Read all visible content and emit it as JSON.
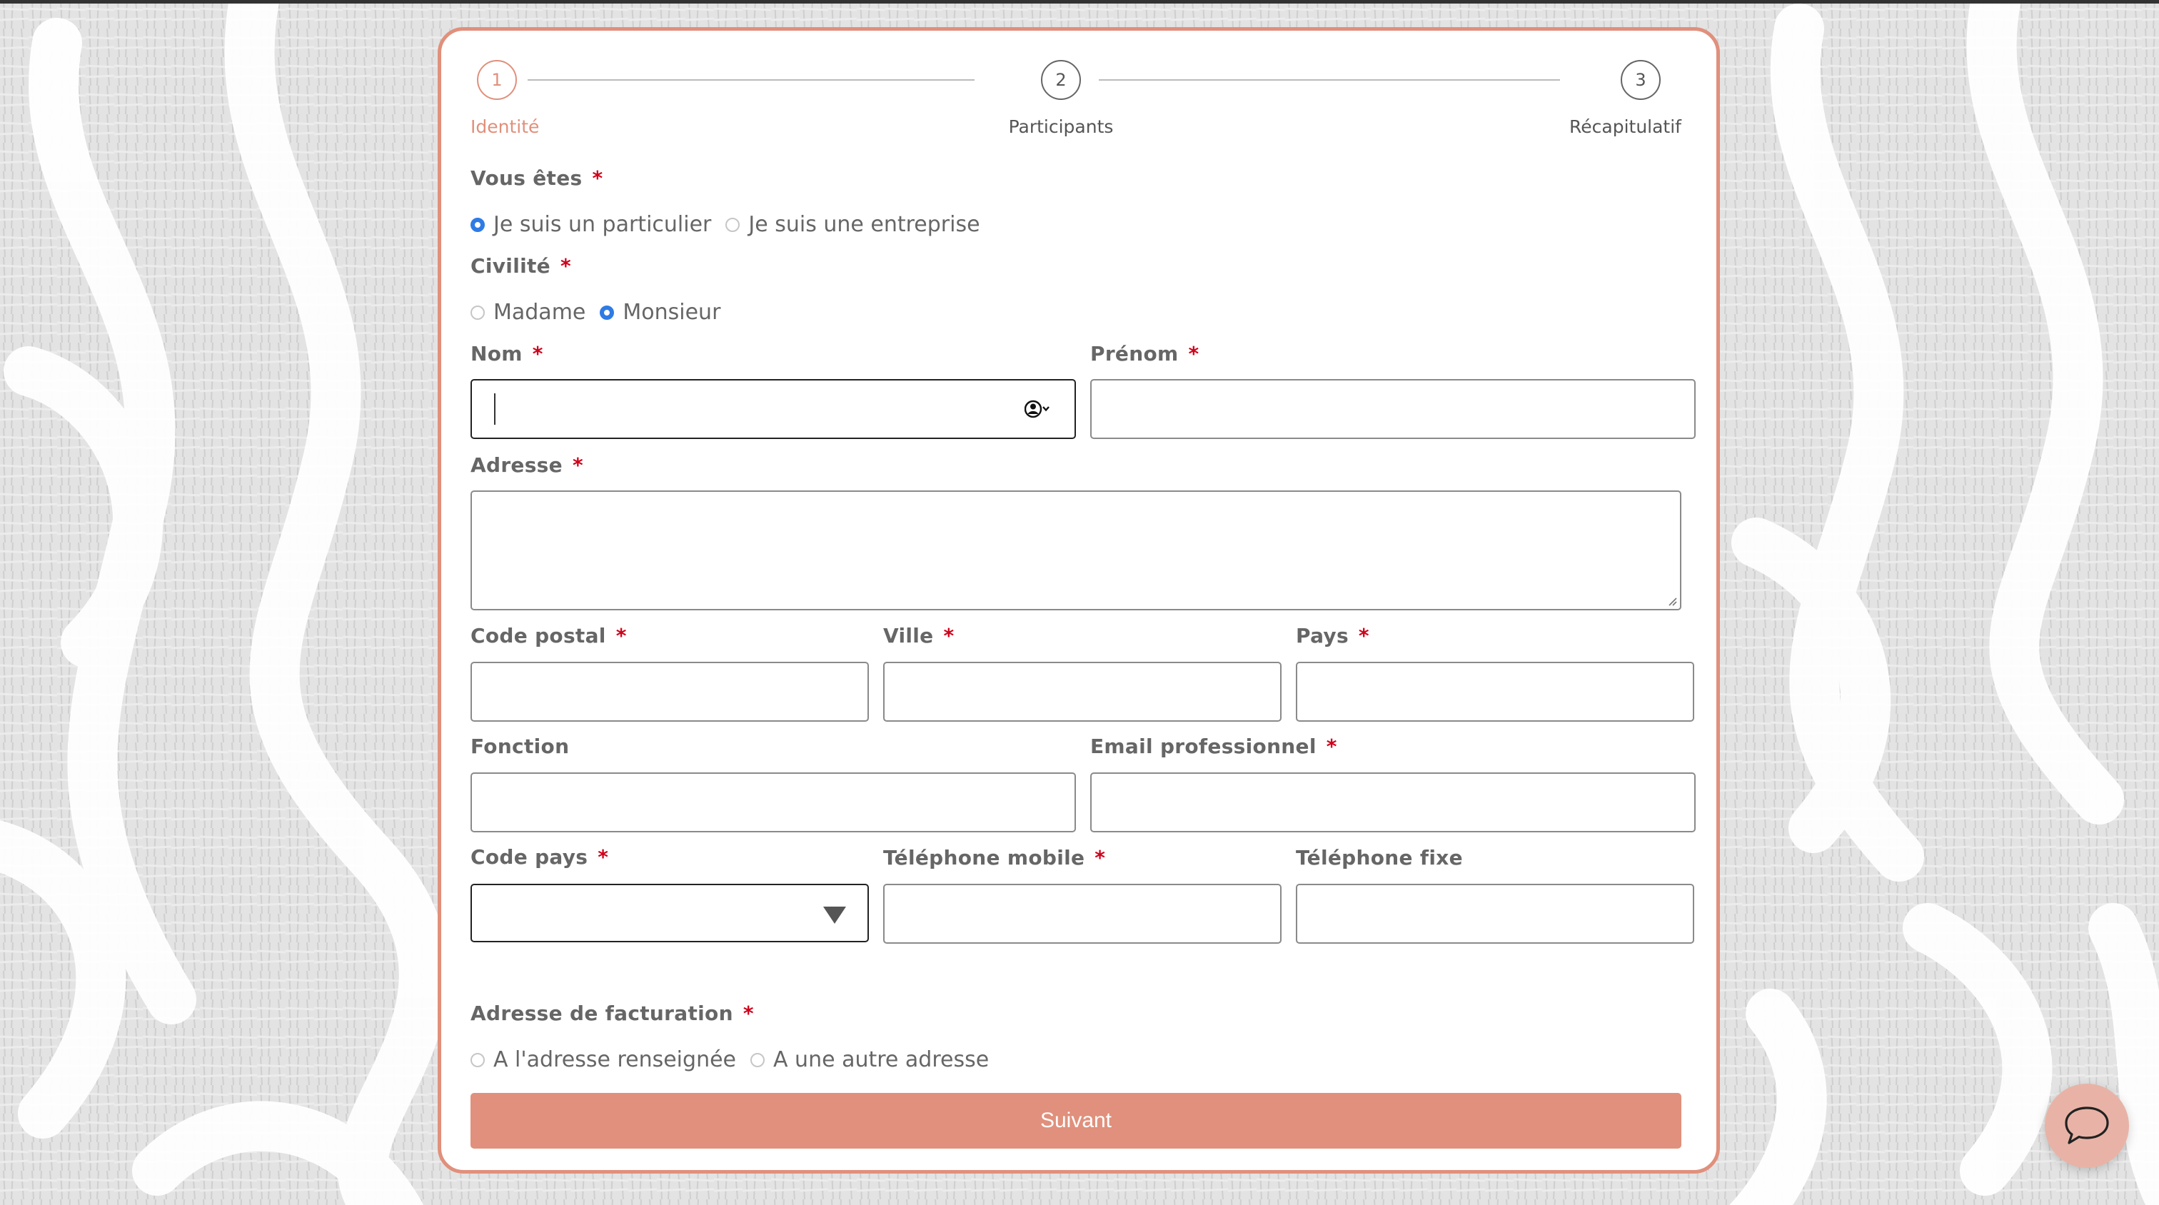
{
  "theme": {
    "accent": "#e0907c",
    "radio_checked": "#2f7be5",
    "required": "#d0021b"
  },
  "stepper": {
    "active_index": 0,
    "steps": [
      {
        "number": "1",
        "label": "Identité"
      },
      {
        "number": "2",
        "label": "Participants"
      },
      {
        "number": "3",
        "label": "Récapitulatif"
      }
    ]
  },
  "form": {
    "vous_etes": {
      "label": "Vous êtes",
      "required": "*",
      "options": [
        {
          "label": "Je suis un particulier",
          "checked": true
        },
        {
          "label": "Je suis une entreprise",
          "checked": false
        }
      ]
    },
    "civilite": {
      "label": "Civilité",
      "required": "*",
      "options": [
        {
          "label": "Madame",
          "checked": false
        },
        {
          "label": "Monsieur",
          "checked": true
        }
      ]
    },
    "nom": {
      "label": "Nom",
      "required": "*",
      "value": "",
      "icon": "contact-autofill-icon"
    },
    "prenom": {
      "label": "Prénom",
      "required": "*",
      "value": ""
    },
    "adresse": {
      "label": "Adresse",
      "required": "*",
      "value": ""
    },
    "code_postal": {
      "label": "Code postal",
      "required": "*",
      "value": ""
    },
    "ville": {
      "label": "Ville",
      "required": "*",
      "value": ""
    },
    "pays": {
      "label": "Pays",
      "required": "*",
      "value": ""
    },
    "fonction": {
      "label": "Fonction",
      "value": ""
    },
    "email": {
      "label": "Email professionnel",
      "required": "*",
      "value": ""
    },
    "code_pays": {
      "label": "Code pays",
      "required": "*",
      "selected": ""
    },
    "tel_mobile": {
      "label": "Téléphone mobile",
      "required": "*",
      "value": ""
    },
    "tel_fixe": {
      "label": "Téléphone fixe",
      "value": ""
    },
    "facturation": {
      "label": "Adresse de facturation",
      "required": "*",
      "options": [
        {
          "label": "A l'adresse renseignée",
          "checked": false
        },
        {
          "label": "A une autre adresse",
          "checked": false
        }
      ]
    },
    "submit_label": "Suivant"
  },
  "chat_widget": {
    "icon": "chat-bubble-icon"
  }
}
